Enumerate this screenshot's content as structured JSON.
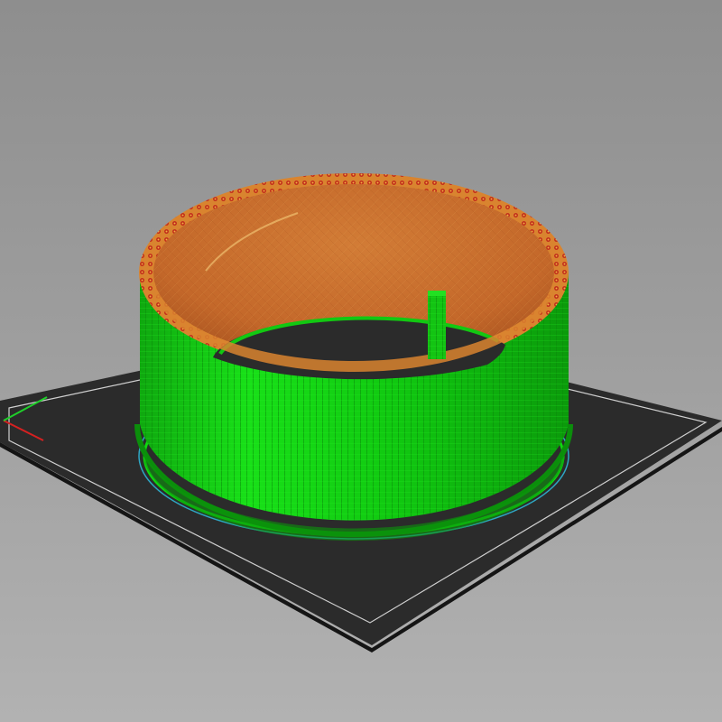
{
  "viewport": {
    "view": "3d-preview",
    "background_top": "#8e8e8e",
    "background_bottom": "#b2b2b2"
  },
  "bed": {
    "fill": "#2a2a2a",
    "edge_fill": "#1c1c1c",
    "outline": "#d8d8d8"
  },
  "axes": {
    "x_color": "#d62020",
    "y_color": "#1fcf2a"
  },
  "model": {
    "shape": "cylindrical-ring",
    "features": {
      "external_perimeter_color": "#10d810",
      "external_perimeter_dark": "#0aa50a",
      "perimeter_color": "#e07826",
      "top_solid_infill_color": "#c8642a",
      "infill_color": "#b81a12",
      "skirt_color": "#10d810",
      "travel_color": "#2fb4d4"
    },
    "extras": [
      "internal-support-post"
    ]
  }
}
